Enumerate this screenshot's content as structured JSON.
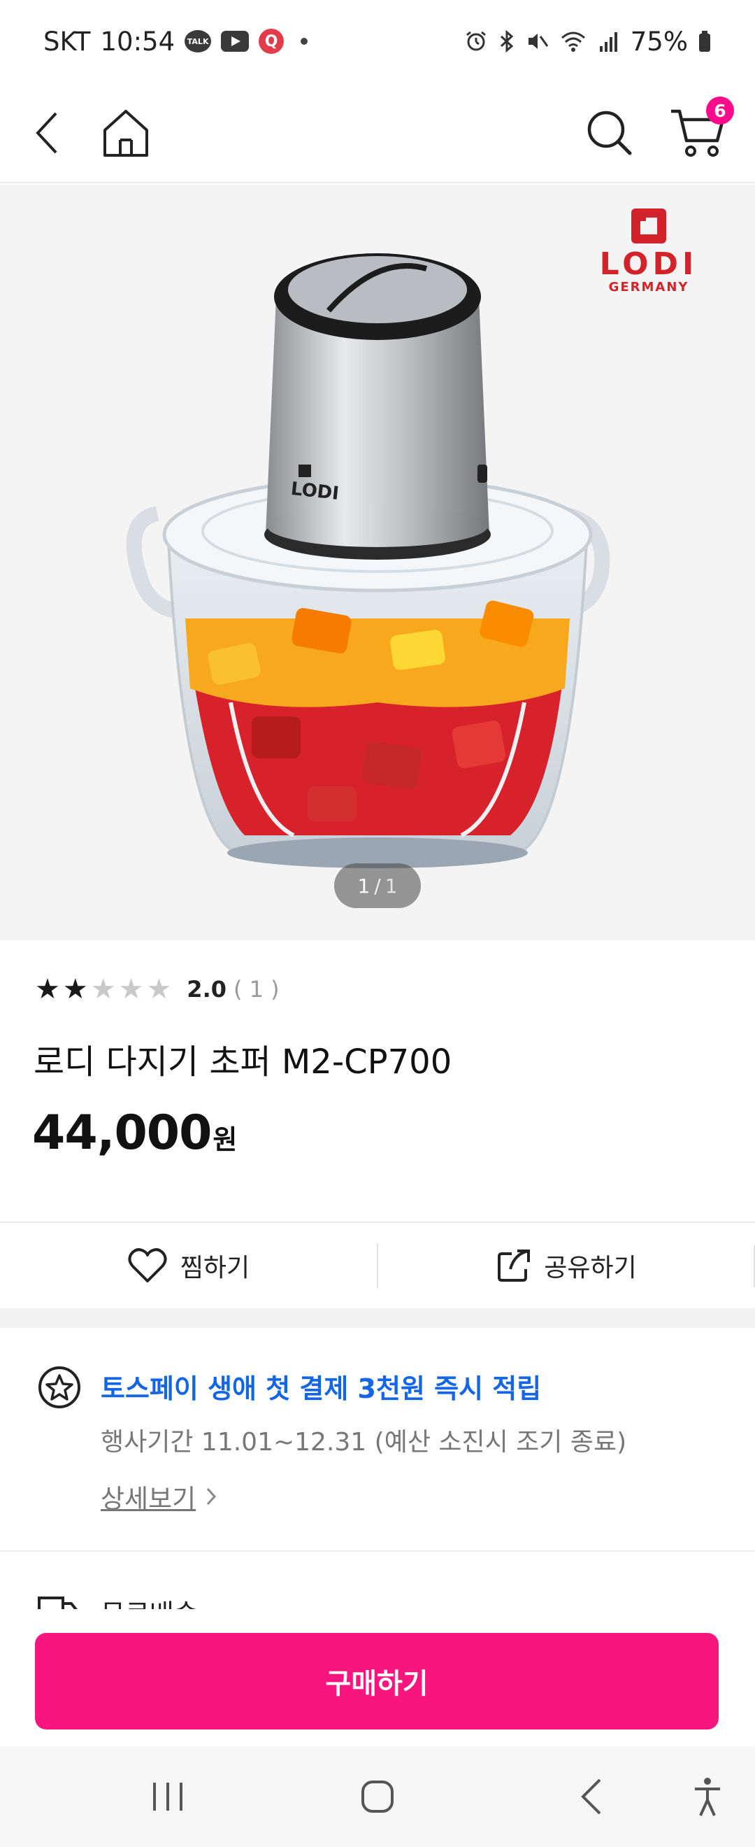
{
  "status_bar": {
    "carrier": "SKT",
    "time": "10:54",
    "talk_label": "TALK",
    "q_label": "Q",
    "battery": "75%"
  },
  "nav": {
    "cart_count": "6"
  },
  "gallery": {
    "current": "1",
    "separator": "/",
    "total": "1",
    "brand_logo": "LODI",
    "brand_sub": "GERMANY"
  },
  "product": {
    "rating": {
      "score": "2.0",
      "count": "( 1 )",
      "stars_filled": 2,
      "stars_total": 5
    },
    "name": "로디 다지기 초퍼 M2-CP700",
    "price": "44,000",
    "price_unit": "원"
  },
  "actions": {
    "wish_label": "찜하기",
    "share_label": "공유하기"
  },
  "promo": {
    "title": "토스페이 생애 첫 결제 3천원 즉시 적립",
    "period": "행사기간 11.01~12.31 (예산 소진시 조기 종료)",
    "detail_link": "상세보기"
  },
  "shipping": {
    "label": "무료배송"
  },
  "buy": {
    "label": "구매하기"
  },
  "colors": {
    "accent_pink": "#f8157e",
    "badge_pink": "#ff0a8a",
    "promo_blue": "#1566e6"
  },
  "icons": [
    "back-icon",
    "home-icon",
    "search-icon",
    "cart-icon",
    "heart-icon",
    "share-icon",
    "star-badge-icon",
    "truck-icon",
    "recents-icon",
    "home-circle-icon",
    "nav-back-icon",
    "accessibility-icon"
  ]
}
